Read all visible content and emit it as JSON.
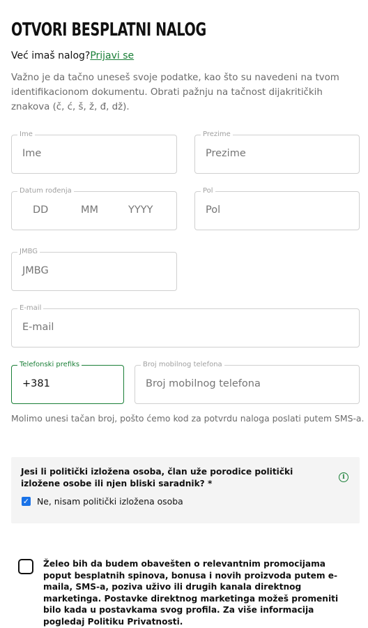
{
  "header": {
    "title": "OTVORI BESPLATNI NALOG",
    "have_account": "Već imaš nalog?",
    "login_link": "Prijavi se"
  },
  "intro_text": "Važno je da tačno uneseš svoje podatke, kao što su navedeni na tvom identifikacionom dokumentu. Obrati pažnju na tačnost dijakritičkih znakova (č, ć, š, ž, đ, dž).",
  "form": {
    "first_name": {
      "label": "Ime",
      "placeholder": "Ime"
    },
    "last_name": {
      "label": "Prezime",
      "placeholder": "Prezime"
    },
    "dob": {
      "label": "Datum rođenja",
      "day": "DD",
      "month": "MM",
      "year": "YYYY"
    },
    "gender": {
      "label": "Pol",
      "placeholder": "Pol"
    },
    "jmbg": {
      "label": "JMBG",
      "placeholder": "JMBG"
    },
    "email": {
      "label": "E-mail",
      "placeholder": "E-mail"
    },
    "phone_prefix": {
      "label": "Telefonski prefiks",
      "value": "+381"
    },
    "phone": {
      "label": "Broj mobilnog telefona",
      "placeholder": "Broj mobilnog telefona"
    },
    "phone_hint": "Molimo unesi tačan broj, pošto ćemo kod za potvrdu naloga poslati putem SMS-a."
  },
  "pep": {
    "question": "Jesi li politički izložena osoba, član uže porodice politički izložene osobe ili njen bliski saradnik? *",
    "checkbox_label": "Ne, nisam politički izložena osoba",
    "checked": true,
    "info_icon": "info-icon"
  },
  "marketing": {
    "text": "Želeo bih da budem obavešten o relevantnim promocijama poput besplatnih spinova, bonusa i novih proizvoda putem e-maila, SMS-a, poziva uživo ili drugih kanala direktnog marketinga. Postavke direktnog marketinga možeš promeniti bilo kada u postavkama svog profila. Za više informacija pogledaj Politiku Privatnosti.",
    "checked": false
  },
  "colors": {
    "accent_green": "#1a7f37",
    "checkbox_blue": "#1a73e8",
    "panel_bg": "#f4f4f4"
  }
}
